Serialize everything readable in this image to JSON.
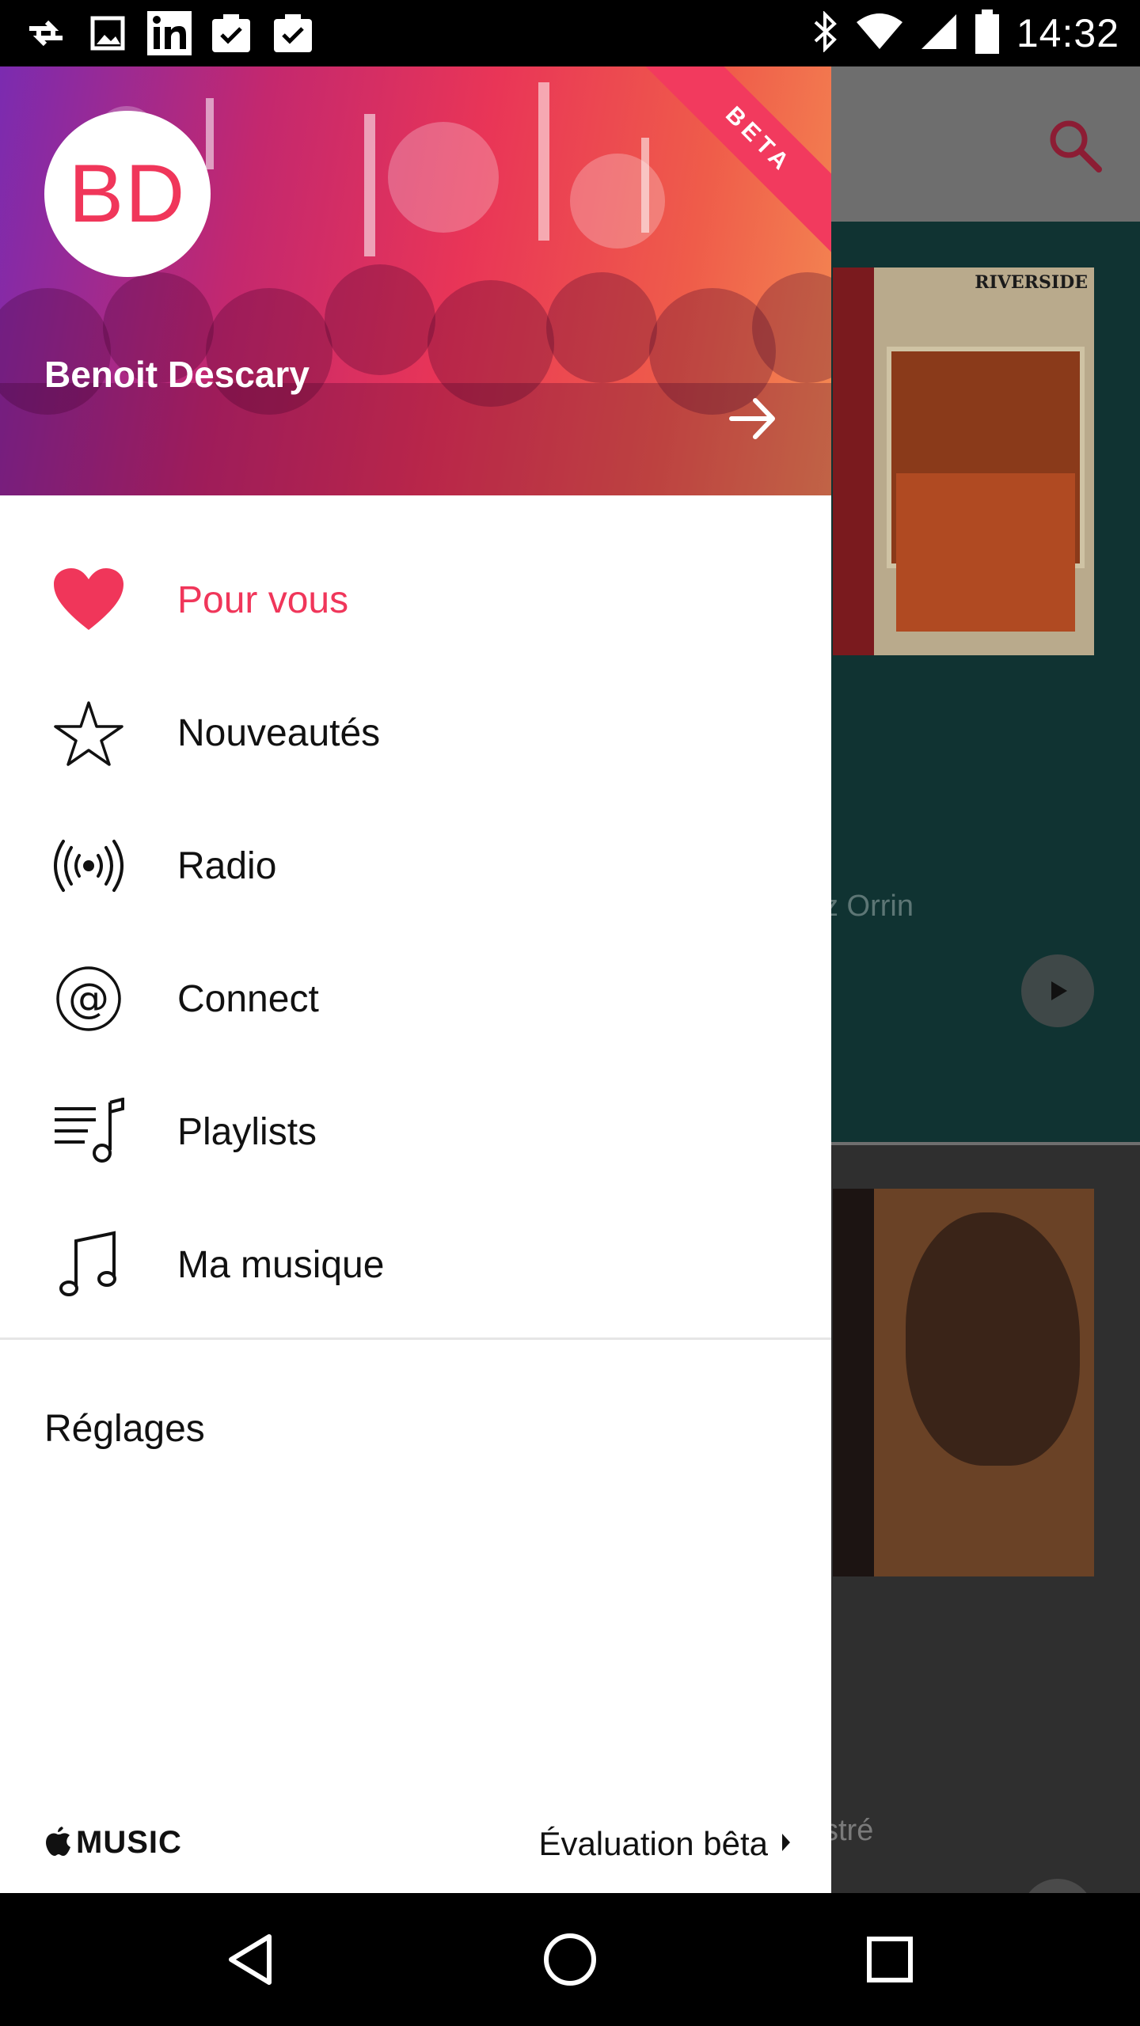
{
  "status_bar": {
    "time": "14:32",
    "left_icons": [
      "sync-icon",
      "image-icon",
      "linkedin-icon",
      "clipboard-check-icon",
      "clipboard-check-icon"
    ],
    "right_icons": [
      "bluetooth-icon",
      "wifi-icon",
      "signal-icon",
      "battery-icon"
    ]
  },
  "drawer": {
    "beta_badge": "BETA",
    "avatar_initials": "BD",
    "user_name": "Benoit Descary",
    "menu": [
      {
        "label": "Pour vous",
        "icon": "heart-icon",
        "active": true
      },
      {
        "label": "Nouveautés",
        "icon": "star-icon",
        "active": false
      },
      {
        "label": "Radio",
        "icon": "radio-broadcast-icon",
        "active": false
      },
      {
        "label": "Connect",
        "icon": "at-sign-icon",
        "active": false
      },
      {
        "label": "Playlists",
        "icon": "playlist-icon",
        "active": false
      },
      {
        "label": "Ma musique",
        "icon": "music-note-icon",
        "active": false
      }
    ],
    "settings_label": "Réglages",
    "footer": {
      "brand": "MUSIC",
      "beta_eval": "Évaluation bêta"
    }
  },
  "background": {
    "album1_tag": "RIVERSIDE",
    "card1_text": "z Orrin",
    "card2_text": "stré"
  },
  "colors": {
    "accent": "#f0365a",
    "header_gradient_start": "#7b2bb0",
    "header_gradient_end": "#f48a52"
  }
}
